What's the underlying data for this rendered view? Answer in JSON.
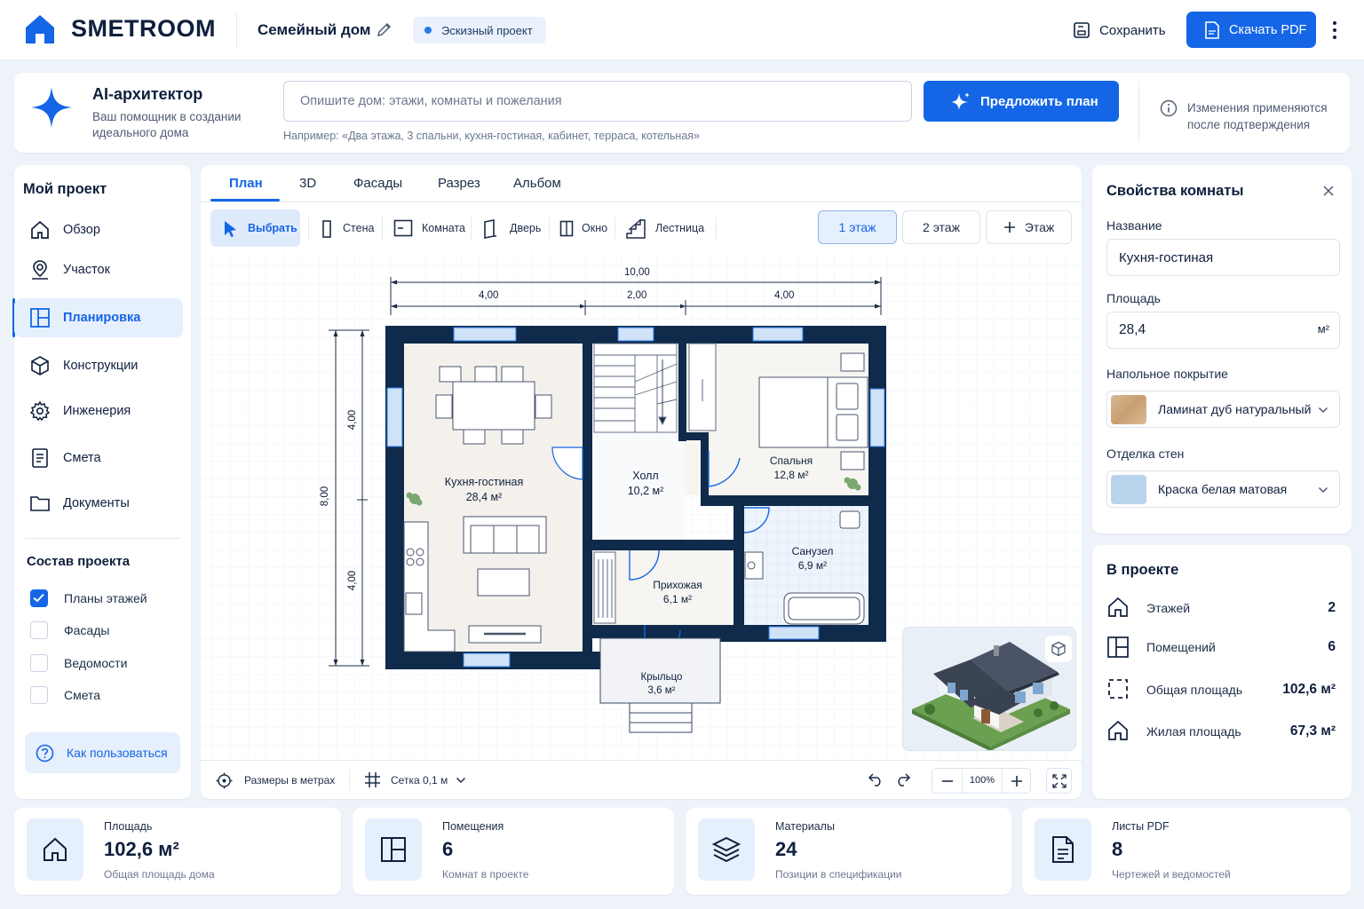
{
  "header": {
    "logo": "SMETROOM",
    "project_name": "Семейный дом",
    "status_badge": "Эскизный проект",
    "save_label": "Сохранить",
    "download_label": "Скачать PDF"
  },
  "ai": {
    "title": "AI-архитектор",
    "subtitle": "Ваш помощник в создании идеального дома",
    "placeholder": "Опишите дом: этажи, комнаты и пожелания",
    "hint": "Например: «Два этажа, 3 спальни, кухня-гостиная, кабинет, терраса, котельная»",
    "button": "Предложить план",
    "note": "Изменения применяются после подтверждения"
  },
  "sidebar": {
    "title": "Мой проект",
    "items": [
      {
        "label": "Обзор",
        "icon": "home-icon"
      },
      {
        "label": "Участок",
        "icon": "location-pin-icon"
      },
      {
        "label": "Планировка",
        "icon": "floor-plan-icon",
        "active": true
      },
      {
        "label": "Конструкции",
        "icon": "cube-icon"
      },
      {
        "label": "Инженерия",
        "icon": "gear-icon"
      },
      {
        "label": "Смета",
        "icon": "document-icon"
      },
      {
        "label": "Документы",
        "icon": "folder-icon"
      }
    ],
    "composition_title": "Состав проекта",
    "composition": [
      {
        "label": "Планы этажей",
        "checked": true
      },
      {
        "label": "Фасады",
        "checked": false
      },
      {
        "label": "Ведомости",
        "checked": false
      },
      {
        "label": "Смета",
        "checked": false
      }
    ],
    "help_label": "Как пользоваться"
  },
  "tabs": [
    "План",
    "3D",
    "Фасады",
    "Разрез",
    "Альбом"
  ],
  "tools": [
    "Выбрать",
    "Стена",
    "Комната",
    "Дверь",
    "Окно",
    "Лестница"
  ],
  "floors": [
    "1 этаж",
    "2 этаж",
    "Этаж"
  ],
  "plan": {
    "dims_top": {
      "total": "10,00",
      "a": "4,00",
      "b": "2,00",
      "c": "4,00"
    },
    "dims_left": {
      "total": "8,00",
      "a": "4,00",
      "b": "4,00"
    },
    "rooms": [
      {
        "name": "Кухня-гостиная",
        "area": "28,4 м²"
      },
      {
        "name": "Холл",
        "area": "10,2 м²"
      },
      {
        "name": "Спальня",
        "area": "12,8 м²"
      },
      {
        "name": "Санузел",
        "area": "6,9 м²"
      },
      {
        "name": "Прихожая",
        "area": "6,1 м²"
      },
      {
        "name": "Крыльцо",
        "area": "3,6 м²"
      }
    ]
  },
  "bottom_bar": {
    "units": "Размеры в метрах",
    "grid": "Сетка 0,1 м",
    "zoom": "100%"
  },
  "room_props": {
    "title": "Свойства комнаты",
    "name_label": "Название",
    "name_value": "Кухня-гостиная",
    "area_label": "Площадь",
    "area_value": "28,4",
    "area_unit": "м²",
    "floor_label": "Напольное покрытие",
    "floor_value": "Ламинат дуб натуральный",
    "walls_label": "Отделка стен",
    "walls_value": "Краска белая матовая"
  },
  "in_project": {
    "title": "В проекте",
    "rows": [
      {
        "label": "Этажей",
        "value": "2"
      },
      {
        "label": "Помещений",
        "value": "6"
      },
      {
        "label": "Общая площадь",
        "value": "102,6 м²"
      },
      {
        "label": "Жилая площадь",
        "value": "67,3 м²"
      }
    ]
  },
  "stats": [
    {
      "label": "Площадь",
      "value": "102,6 м²",
      "sub": "Общая площадь дома"
    },
    {
      "label": "Помещения",
      "value": "6",
      "sub": "Комнат в проекте"
    },
    {
      "label": "Материалы",
      "value": "24",
      "sub": "Позиции в спецификации"
    },
    {
      "label": "Листы PDF",
      "value": "8",
      "sub": "Чертежей и ведомостей"
    }
  ],
  "colors": {
    "accent": "#1466e6",
    "wall": "#0f2a4a",
    "window": "#bcd6f5",
    "bg": "#eef3fa"
  }
}
